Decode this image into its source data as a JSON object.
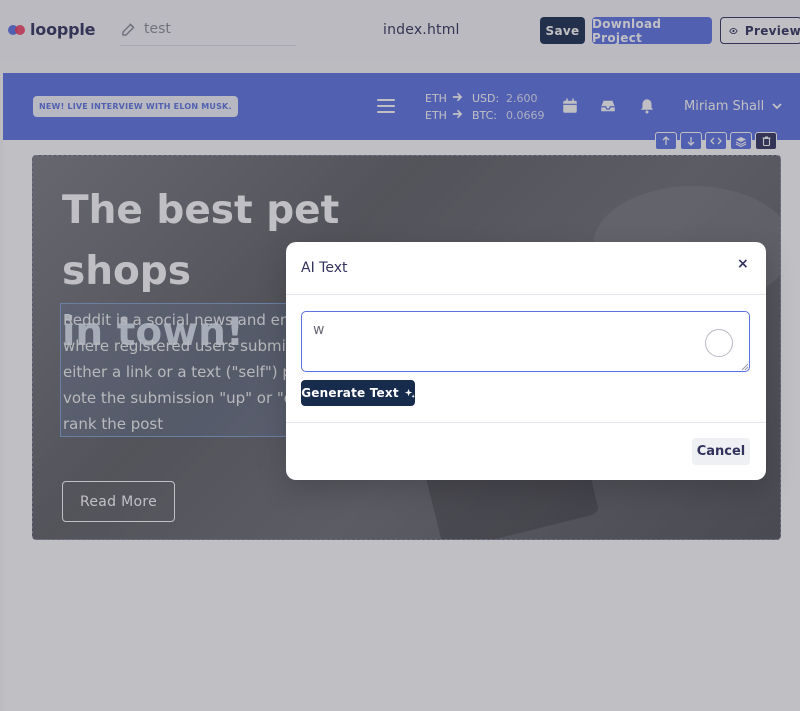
{
  "editor": {
    "logo_text": "loopple",
    "project_name": "test",
    "file_title": "index.html",
    "save_label": "Save",
    "download_label": "Download Project",
    "preview_label": "Preview"
  },
  "site": {
    "promo_badge": "NEW! LIVE INTERVIEW WITH ELON MUSK.",
    "rates": [
      {
        "from": "ETH",
        "to": "USD:",
        "value": "2.600"
      },
      {
        "from": "ETH",
        "to": "BTC:",
        "value": "0.0669"
      }
    ],
    "user_name": "Miriam Shall",
    "hero": {
      "title_line1": "The best pet shops",
      "title_line2": "in town!",
      "text_lines": [
        "Reddit is a social news and ente",
        "where registered users submit c",
        "either a link or a text (\"self\") pos",
        "vote the submission \"up\" or \"do",
        "rank the post"
      ],
      "read_more": "Read More"
    }
  },
  "modal": {
    "title": "AI Text",
    "close": "×",
    "input_value": "w",
    "generate_label": "Generate Text",
    "cancel_label": "Cancel"
  },
  "colors": {
    "primary": "#5e72e4",
    "dark": "#172b4d",
    "text": "#32325d"
  }
}
